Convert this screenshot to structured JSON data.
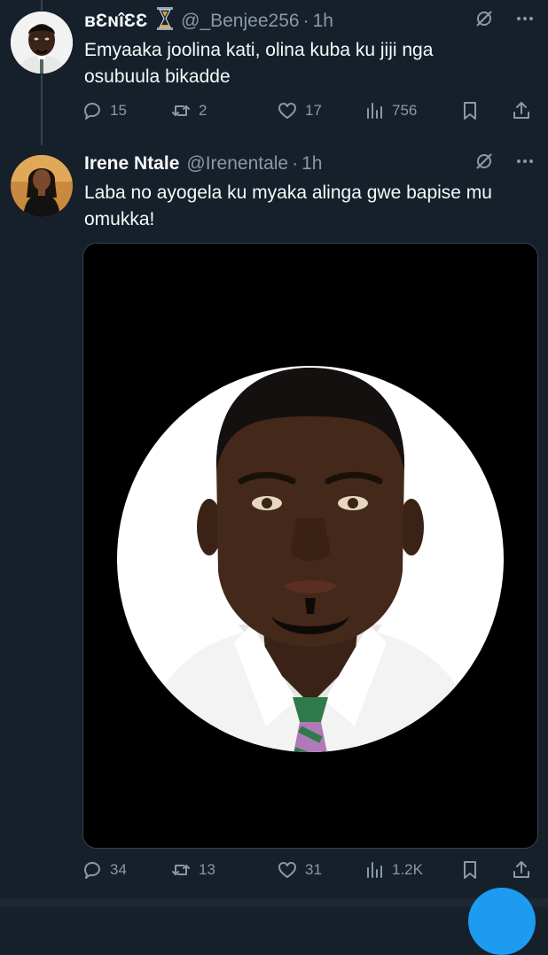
{
  "tweets": [
    {
      "name": "ʙƐɴîƐƐ",
      "handle": "@_Benjee256",
      "time": "1h",
      "text_lines": [
        "Emyaaka joolina kati, olina kuba ku jiji nga",
        "osubuula bikadde"
      ],
      "replies": "15",
      "retweets": "2",
      "likes": "17",
      "views": "756"
    },
    {
      "name": "Irene Ntale",
      "handle": "@Irenentale",
      "time": "1h",
      "text_lines": [
        "Laba no ayogela ku myaka alinga gwe bapise mu",
        "omukka!"
      ],
      "replies": "34",
      "retweets": "13",
      "likes": "31",
      "views": "1.2K"
    }
  ],
  "separator": "·",
  "icons": {
    "hourglass": "hourglass-icon",
    "grok": "grok-icon",
    "more": "more-icon",
    "reply": "reply-icon",
    "retweet": "retweet-icon",
    "like": "like-icon",
    "views": "views-icon",
    "bookmark": "bookmark-icon",
    "share": "share-icon"
  },
  "colors": {
    "background": "#15202b",
    "text": "#f7f9f9",
    "muted": "#8b98a5",
    "accent": "#1d9bf0"
  }
}
